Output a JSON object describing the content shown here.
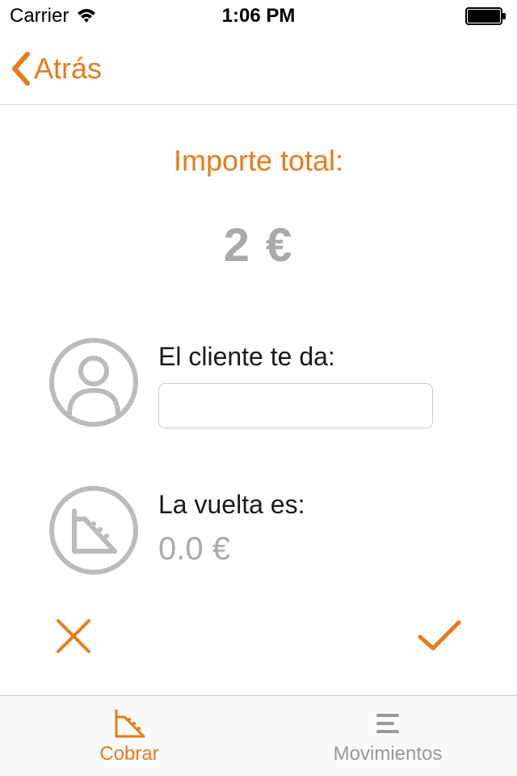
{
  "status": {
    "carrier": "Carrier",
    "time": "1:06 PM"
  },
  "nav": {
    "back": "Atrás"
  },
  "main": {
    "totalLabel": "Importe total:",
    "totalAmount": "2 €",
    "clientGivesLabel": "El cliente te da:",
    "clientGivesValue": "",
    "changeLabel": "La vuelta es:",
    "changeValue": "0.0 €"
  },
  "tabs": {
    "cobrar": "Cobrar",
    "movimientos": "Movimientos"
  }
}
